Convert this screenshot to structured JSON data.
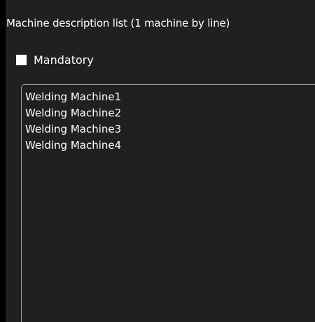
{
  "form": {
    "header_label": "Machine description list (1 machine by line)",
    "mandatory_checkbox": {
      "label": "Mandatory",
      "checked": false
    },
    "machines_textarea": {
      "lines": [
        "Welding Machine1",
        "Welding Machine2",
        "Welding Machine3",
        "Welding Machine4"
      ]
    }
  },
  "colors": {
    "page_background": "#000000",
    "panel_background": "#202020",
    "text": "#ffffff",
    "border": "#9e9e9e"
  }
}
